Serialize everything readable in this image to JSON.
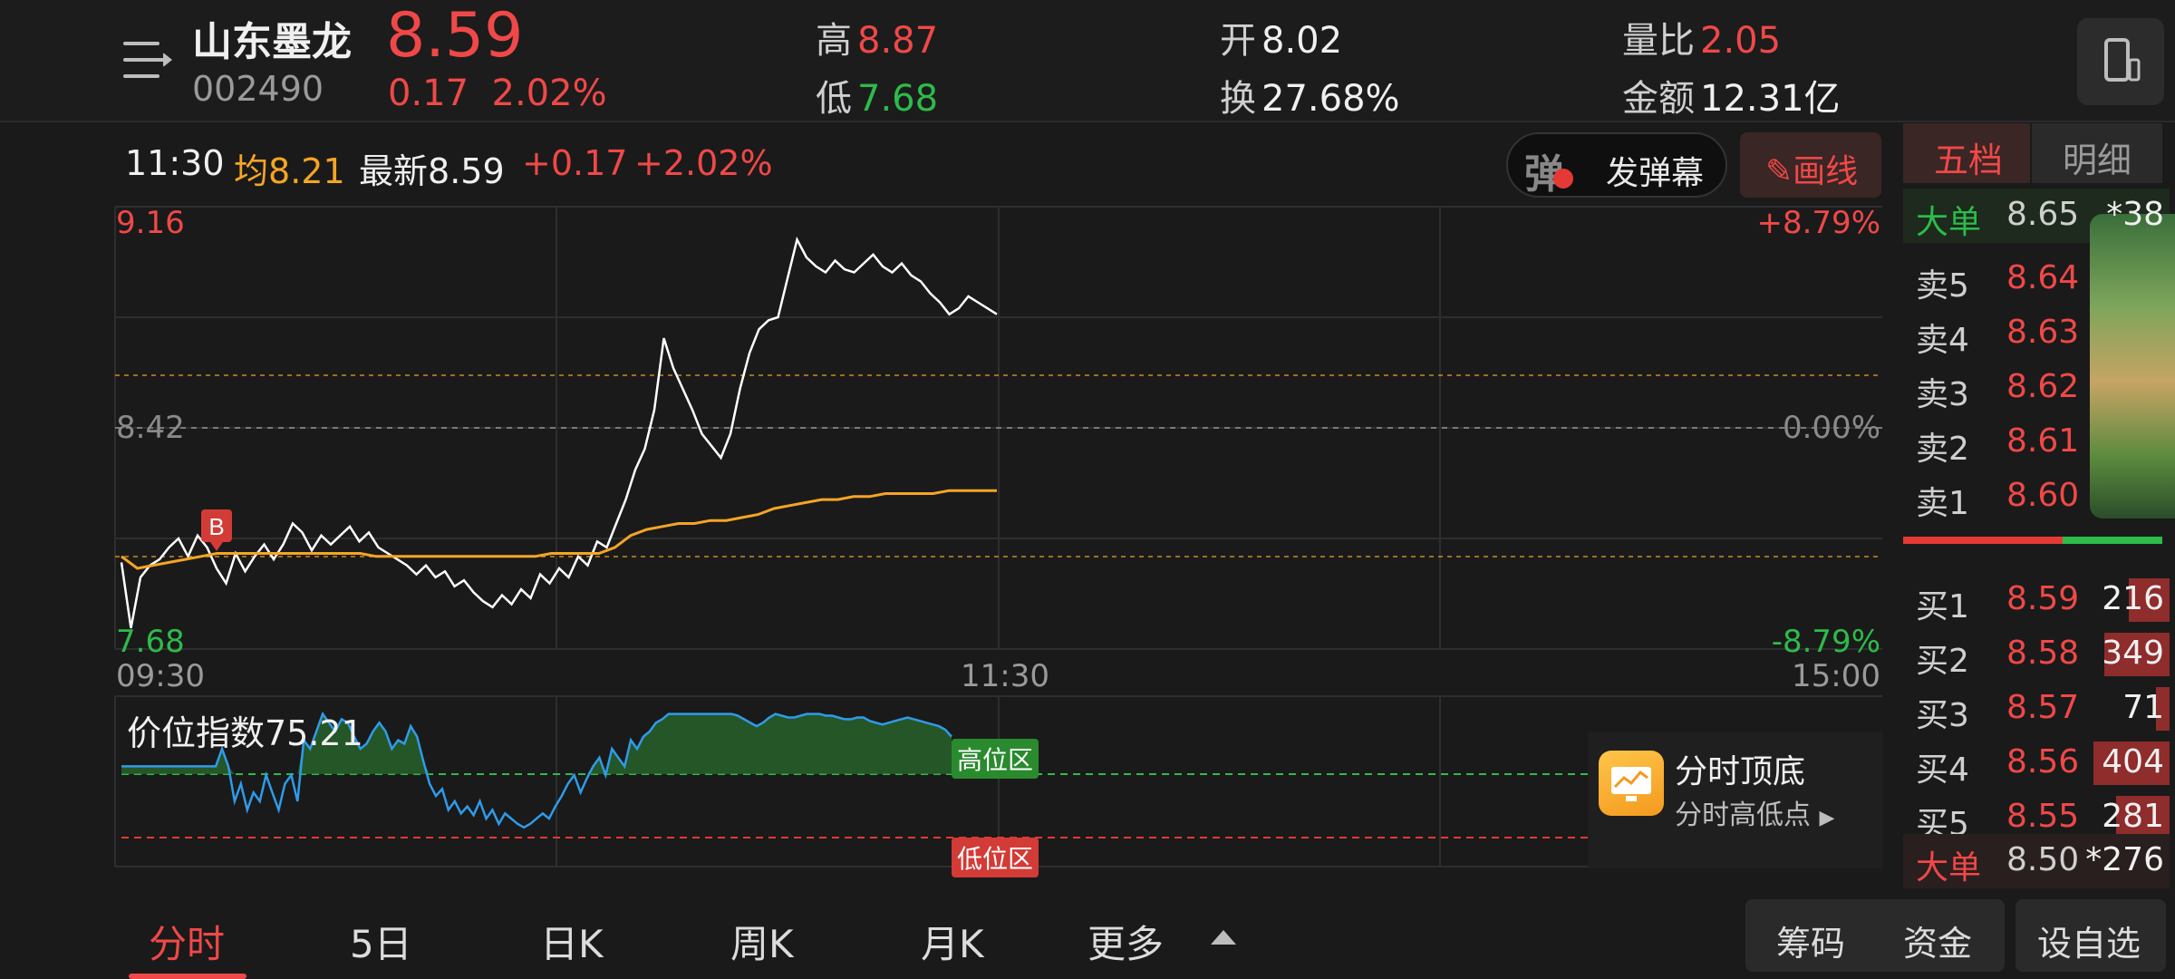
{
  "header": {
    "stock_name": "山东墨龙",
    "stock_code": "002490",
    "price": "8.59",
    "change_abs": "0.17",
    "change_pct": "2.02%",
    "high_label": "高",
    "high": "8.87",
    "low_label": "低",
    "low": "7.68",
    "open_label": "开",
    "open": "8.02",
    "turnover_label": "换",
    "turnover": "27.68%",
    "vol_ratio_label": "量比",
    "vol_ratio": "2.05",
    "amount_label": "金额",
    "amount": "12.31亿"
  },
  "info_row": {
    "time": "11:30",
    "avg_label": "均",
    "avg": "8.21",
    "latest_label": "最新",
    "latest": "8.59",
    "change_abs": "+0.17",
    "change_pct": "+2.02%",
    "danmu_icon": "弹",
    "danmu_button": "发弹幕",
    "draw_button": "画线"
  },
  "chart_data": [
    {
      "type": "line",
      "y_axis_left": [
        "9.16",
        "8.42",
        "7.68"
      ],
      "y_axis_right": [
        "+8.79%",
        "0.00%",
        "-8.79%"
      ],
      "x_ticks": [
        "09:30",
        "11:30",
        "15:00"
      ],
      "ylim": [
        7.68,
        9.16
      ],
      "reference": 8.42,
      "marker": "B",
      "series": [
        {
          "name": "最新",
          "color": "#ffffff",
          "values": [
            7.97,
            7.75,
            7.92,
            7.96,
            7.98,
            8.02,
            8.05,
            7.99,
            8.06,
            8.02,
            7.95,
            7.9,
            8.0,
            7.94,
            7.99,
            8.03,
            7.98,
            8.03,
            8.1,
            8.07,
            8.01,
            8.06,
            8.03,
            8.06,
            8.09,
            8.04,
            8.07,
            8.02,
            8.0,
            7.98,
            7.96,
            7.93,
            7.96,
            7.92,
            7.94,
            7.89,
            7.91,
            7.87,
            7.84,
            7.82,
            7.86,
            7.83,
            7.88,
            7.85,
            7.93,
            7.9,
            7.95,
            7.92,
            7.99,
            7.96,
            8.04,
            8.02,
            8.1,
            8.18,
            8.28,
            8.35,
            8.48,
            8.72,
            8.62,
            8.55,
            8.48,
            8.4,
            8.36,
            8.32,
            8.4,
            8.55,
            8.67,
            8.75,
            8.78,
            8.79,
            8.92,
            9.05,
            8.99,
            8.96,
            8.94,
            8.98,
            8.95,
            8.94,
            8.97,
            9.0,
            8.96,
            8.94,
            8.97,
            8.93,
            8.91,
            8.87,
            8.84,
            8.8,
            8.82,
            8.86,
            8.84,
            8.82,
            8.8
          ]
        },
        {
          "name": "均",
          "color": "#f5a524",
          "values": [
            7.99,
            7.95,
            7.96,
            7.97,
            7.98,
            7.99,
            8.0,
            8.0,
            8.0,
            8.0,
            8.0,
            8.0,
            8.0,
            8.0,
            8.0,
            8.0,
            7.99,
            7.99,
            7.99,
            7.99,
            7.99,
            7.99,
            7.99,
            7.99,
            7.99,
            7.99,
            7.99,
            8.0,
            8.0,
            8.0,
            8.0,
            8.02,
            8.06,
            8.08,
            8.09,
            8.1,
            8.1,
            8.11,
            8.11,
            8.12,
            8.13,
            8.15,
            8.16,
            8.17,
            8.18,
            8.18,
            8.19,
            8.19,
            8.2,
            8.2,
            8.2,
            8.2,
            8.21,
            8.21,
            8.21,
            8.21
          ]
        }
      ]
    },
    {
      "type": "area",
      "title": "价位指数75.21",
      "high_zone_label": "高位区",
      "low_zone_label": "低位区",
      "series": [
        {
          "name": "价位指数",
          "color": "#2f9bea",
          "values": [
            45,
            45,
            45,
            45,
            45,
            45,
            45,
            45,
            45,
            45,
            45,
            45,
            45,
            45,
            45,
            45,
            55,
            45,
            25,
            35,
            20,
            30,
            25,
            40,
            30,
            20,
            35,
            40,
            25,
            60,
            55,
            65,
            75,
            70,
            65,
            72,
            70,
            62,
            55,
            58,
            65,
            70,
            65,
            55,
            60,
            58,
            68,
            62,
            48,
            35,
            28,
            32,
            20,
            25,
            18,
            22,
            17,
            25,
            15,
            20,
            12,
            18,
            15,
            12,
            10,
            12,
            15,
            18,
            15,
            22,
            28,
            35,
            40,
            30,
            38,
            45,
            50,
            40,
            55,
            50,
            45,
            60,
            55,
            62,
            65,
            70,
            72,
            75,
            75,
            75,
            75,
            75,
            75,
            75,
            75,
            75,
            75,
            75,
            74,
            72,
            70,
            68,
            70,
            73,
            75,
            74,
            73,
            73,
            74,
            75,
            75,
            75,
            74,
            74,
            73,
            72,
            72,
            73,
            73,
            71,
            70,
            69,
            70,
            71,
            72,
            73,
            72,
            71,
            70,
            69,
            68,
            66,
            62
          ]
        }
      ]
    }
  ],
  "right_panel": {
    "tab_five": "五档",
    "tab_detail": "明细",
    "top_big_label": "大单",
    "top_big_price": "8.65",
    "top_big_vol": "*38",
    "sells": [
      {
        "label": "卖5",
        "price": "8.64",
        "vol": "",
        "ratio": 0
      },
      {
        "label": "卖4",
        "price": "8.63",
        "vol": "",
        "ratio": 0
      },
      {
        "label": "卖3",
        "price": "8.62",
        "vol": "",
        "ratio": 0
      },
      {
        "label": "卖2",
        "price": "8.61",
        "vol": "",
        "ratio": 0
      },
      {
        "label": "卖1",
        "price": "8.60",
        "vol": "",
        "ratio": 0
      }
    ],
    "buys": [
      {
        "label": "买1",
        "price": "8.59",
        "vol": "216",
        "ratio": 0.54
      },
      {
        "label": "买2",
        "price": "8.58",
        "vol": "349",
        "ratio": 0.86
      },
      {
        "label": "买3",
        "price": "8.57",
        "vol": "71",
        "ratio": 0.18
      },
      {
        "label": "买4",
        "price": "8.56",
        "vol": "404",
        "ratio": 1.0
      },
      {
        "label": "买5",
        "price": "8.55",
        "vol": "281",
        "ratio": 0.7
      }
    ],
    "bottom_big_label": "大单",
    "bottom_big_price": "8.50",
    "bottom_big_vol": "*276"
  },
  "fenshi_card": {
    "title": "分时顶底",
    "subtitle": "分时高低点"
  },
  "tabs": {
    "items": [
      "分时",
      "5日",
      "日K",
      "周K",
      "月K",
      "更多"
    ],
    "chips": "筹码",
    "funds": "资金",
    "add_watch": "设自选"
  }
}
